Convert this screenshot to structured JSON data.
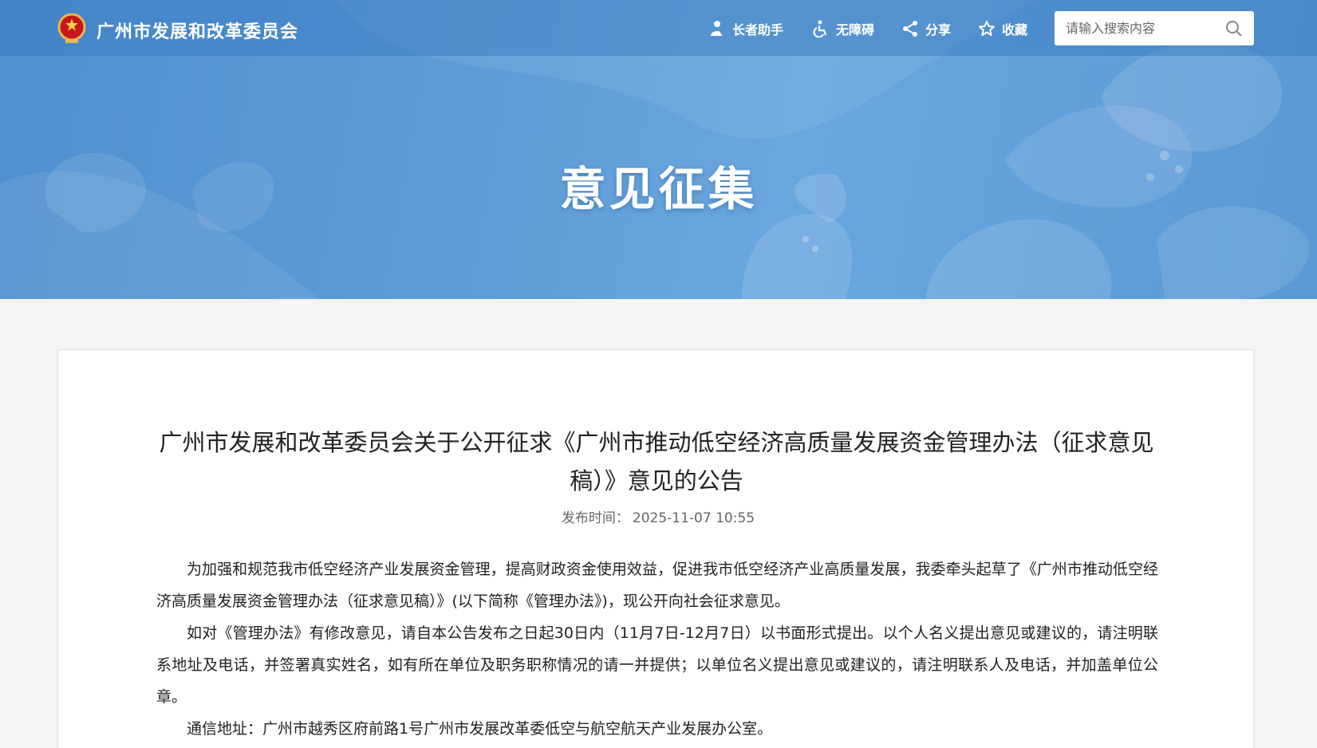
{
  "header": {
    "site_title": "广州市发展和改革委员会",
    "tools": [
      {
        "label": "长者助手",
        "icon": "elder-assist-icon"
      },
      {
        "label": "无障碍",
        "icon": "accessibility-icon"
      },
      {
        "label": "分享",
        "icon": "share-icon"
      },
      {
        "label": "收藏",
        "icon": "star-icon"
      }
    ],
    "search": {
      "placeholder": "请输入搜索内容",
      "value": ""
    }
  },
  "banner": {
    "title": "意见征集"
  },
  "article": {
    "title": "广州市发展和改革委员会关于公开征求《广州市推动低空经济高质量发展资金管理办法（征求意见稿）》意见的公告",
    "publish_label": "发布时间：",
    "publish_time": "2025-11-07 10:55",
    "paragraphs": [
      "为加强和规范我市低空经济产业发展资金管理，提高财政资金使用效益，促进我市低空经济产业高质量发展，我委牵头起草了《广州市推动低空经济高质量发展资金管理办法（征求意见稿）》(以下简称《管理办法》)，现公开向社会征求意见。",
      "如对《管理办法》有修改意见，请自本公告发布之日起30日内（11月7日-12月7日）以书面形式提出。以个人名义提出意见或建议的，请注明联系地址及电话，并签署真实姓名，如有所在单位及职务职称情况的请一并提供；以单位名义提出意见或建议的，请注明联系人及电话，并加盖单位公章。",
      "通信地址：广州市越秀区府前路1号广州市发展改革委低空与航空航天产业发展办公室。"
    ]
  },
  "colors": {
    "banner": "#5e9bd6",
    "topbar": "#3c7dc3",
    "text": "#222222"
  }
}
